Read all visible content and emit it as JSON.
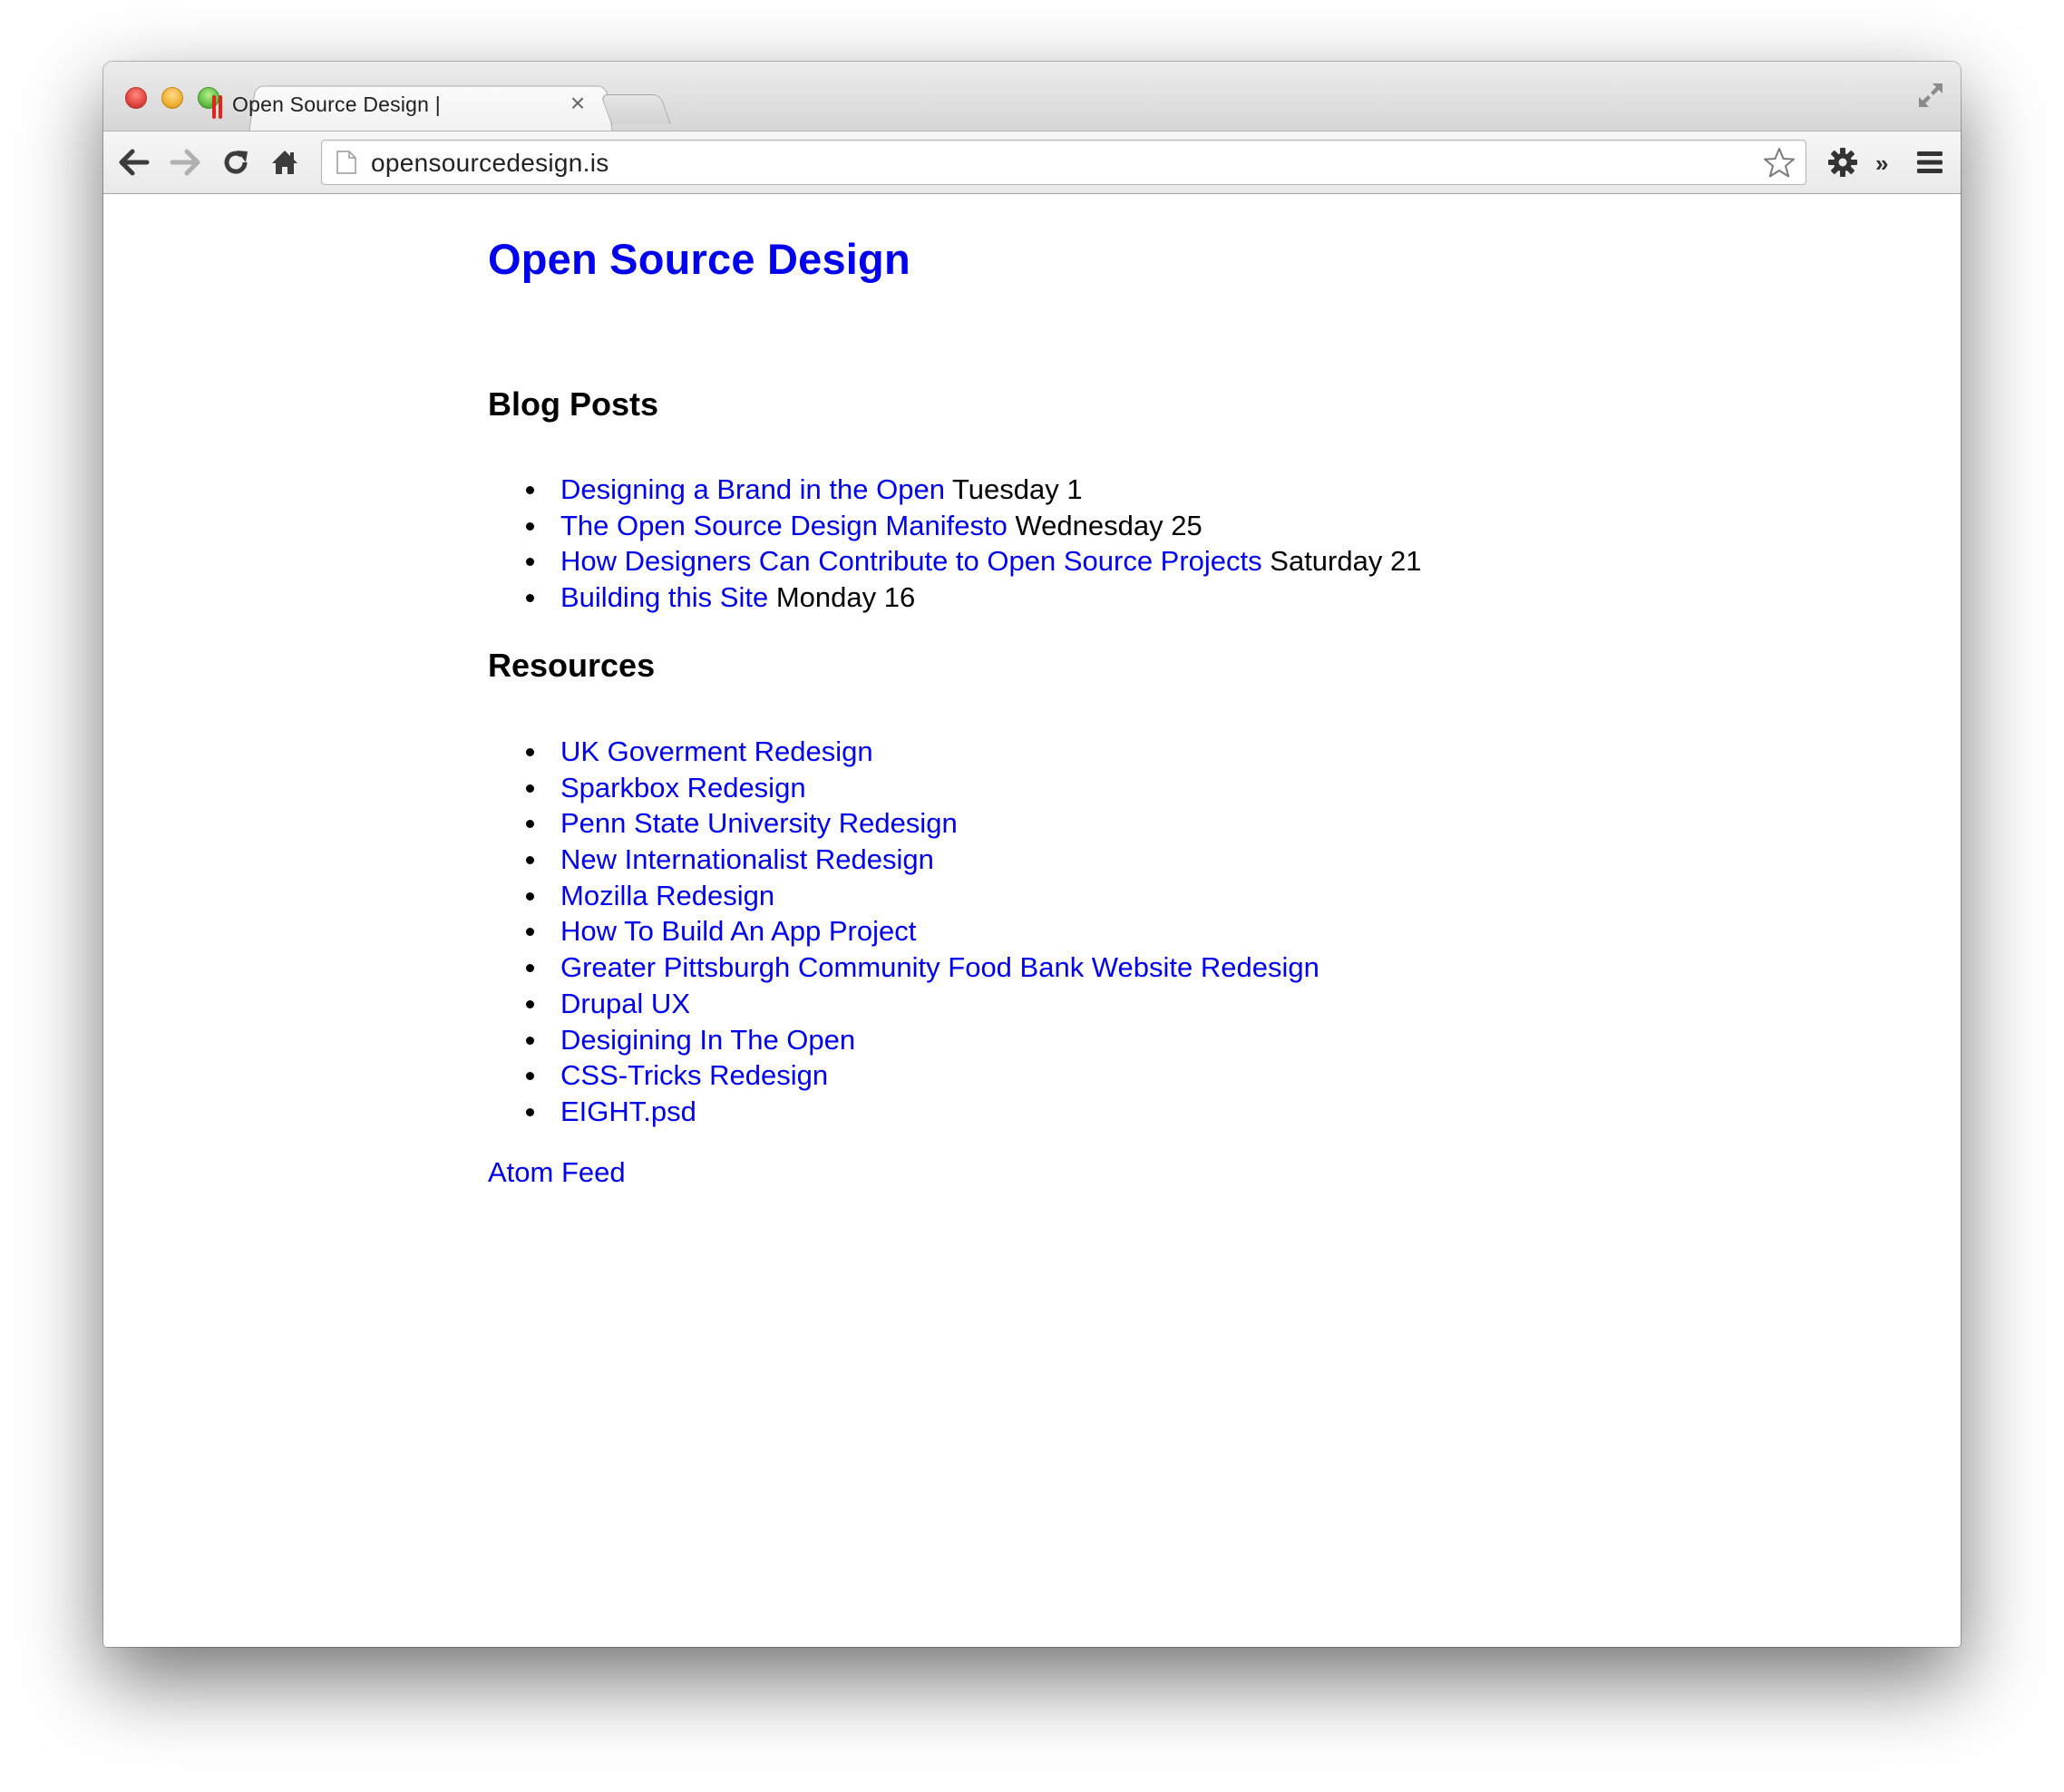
{
  "browser": {
    "tab_title": "Open Source Design |",
    "tab_close": "×",
    "url": "opensourcedesign.is"
  },
  "page": {
    "site_title": "Open Source Design",
    "blog_heading": "Blog Posts",
    "blog_posts": [
      {
        "title": "Designing a Brand in the Open",
        "date": "Tuesday 1"
      },
      {
        "title": "The Open Source Design Manifesto",
        "date": "Wednesday 25"
      },
      {
        "title": "How Designers Can Contribute to Open Source Projects",
        "date": "Saturday 21"
      },
      {
        "title": "Building this Site",
        "date": "Monday 16"
      }
    ],
    "resources_heading": "Resources",
    "resources": [
      "UK Goverment Redesign",
      "Sparkbox Redesign",
      "Penn State University Redesign",
      "New Internationalist Redesign",
      "Mozilla Redesign",
      "How To Build An App Project",
      "Greater Pittsburgh Community Food Bank Website Redesign",
      "Drupal UX",
      "Desigining In The Open",
      "CSS-Tricks Redesign",
      "EIGHT.psd"
    ],
    "feed_link": "Atom Feed"
  },
  "colors": {
    "link": "#0000ee",
    "text": "#000000",
    "favicon": "#e0241e"
  }
}
